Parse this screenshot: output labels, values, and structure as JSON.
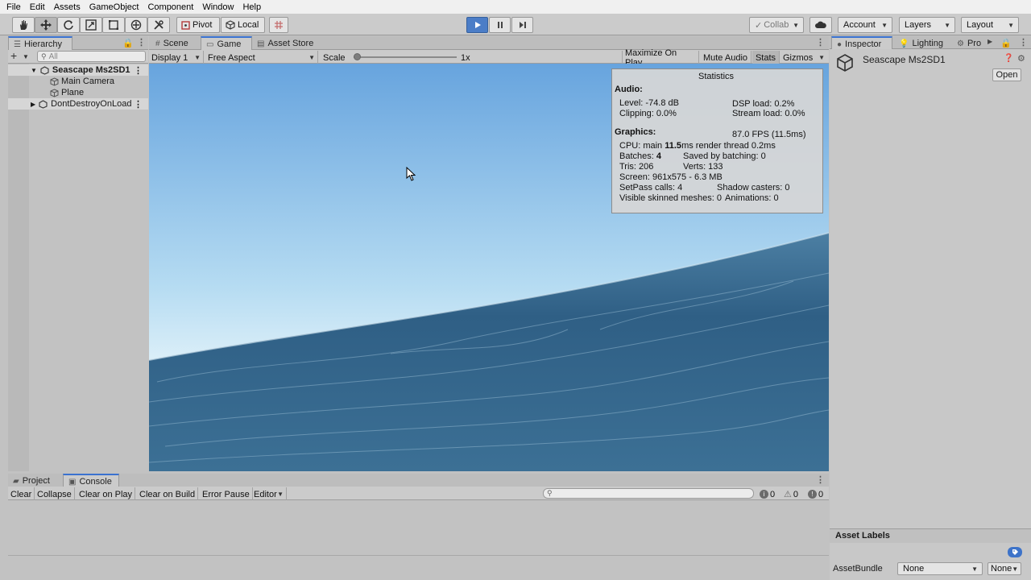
{
  "menubar": [
    "File",
    "Edit",
    "Assets",
    "GameObject",
    "Component",
    "Window",
    "Help"
  ],
  "toolbar": {
    "pivot": "Pivot",
    "local": "Local",
    "collab": "Collab",
    "account": "Account",
    "layers": "Layers",
    "layout": "Layout"
  },
  "hierarchy": {
    "tab": "Hierarchy",
    "search_placeholder": "All",
    "items": [
      {
        "label": "Seascape Ms2SD1"
      },
      {
        "label": "Main Camera"
      },
      {
        "label": "Plane"
      },
      {
        "label": "DontDestroyOnLoad"
      }
    ]
  },
  "center_tabs": {
    "scene": "Scene",
    "game": "Game",
    "asset_store": "Asset Store"
  },
  "game_toolbar": {
    "display": "Display 1",
    "aspect": "Free Aspect",
    "scale_label": "Scale",
    "scale_value": "1x",
    "scale_fraction": 0.0,
    "maximize": "Maximize On Play",
    "mute": "Mute Audio",
    "stats": "Stats",
    "gizmos": "Gizmos"
  },
  "stats": {
    "title": "Statistics",
    "audio_header": "Audio:",
    "level": "Level: -74.8 dB",
    "dsp": "DSP load: 0.2%",
    "clipping": "Clipping: 0.0%",
    "stream": "Stream load: 0.0%",
    "graphics_header": "Graphics:",
    "fps": "87.0 FPS (11.5ms)",
    "cpu_prefix": "CPU: main ",
    "cpu_main": "11.5",
    "cpu_suffix": "ms  render thread 0.2ms",
    "batches_prefix": "Batches: ",
    "batches": "4",
    "saved": "Saved by batching: 0",
    "tris": "Tris: 206",
    "verts": "Verts: 133",
    "screen": "Screen: 961x575 - 6.3 MB",
    "setpass": "SetPass calls: 4",
    "shadow": "Shadow casters: 0",
    "skinned": "Visible skinned meshes: 0",
    "anim": "Animations: 0"
  },
  "inspector": {
    "tab": "Inspector",
    "lighting": "Lighting",
    "project_settings": "Pro",
    "object": "Seascape Ms2SD1",
    "open": "Open",
    "asset_labels": "Asset Labels",
    "assetbundle": "AssetBundle",
    "none1": "None",
    "none2": "None"
  },
  "bottom_tabs": {
    "project": "Project",
    "console": "Console"
  },
  "console": {
    "clear": "Clear",
    "collapse": "Collapse",
    "clear_on_play": "Clear on Play",
    "clear_on_build": "Clear on Build",
    "error_pause": "Error Pause",
    "editor": "Editor",
    "info_count": "0",
    "warn_count": "0",
    "error_count": "0"
  },
  "colors": {
    "accent": "#3a72d0",
    "play_active": "#4b7dc7",
    "sky_top": "#6aa7df",
    "sky_horizon": "#eaf6fb",
    "sea": "#2f5f85"
  }
}
